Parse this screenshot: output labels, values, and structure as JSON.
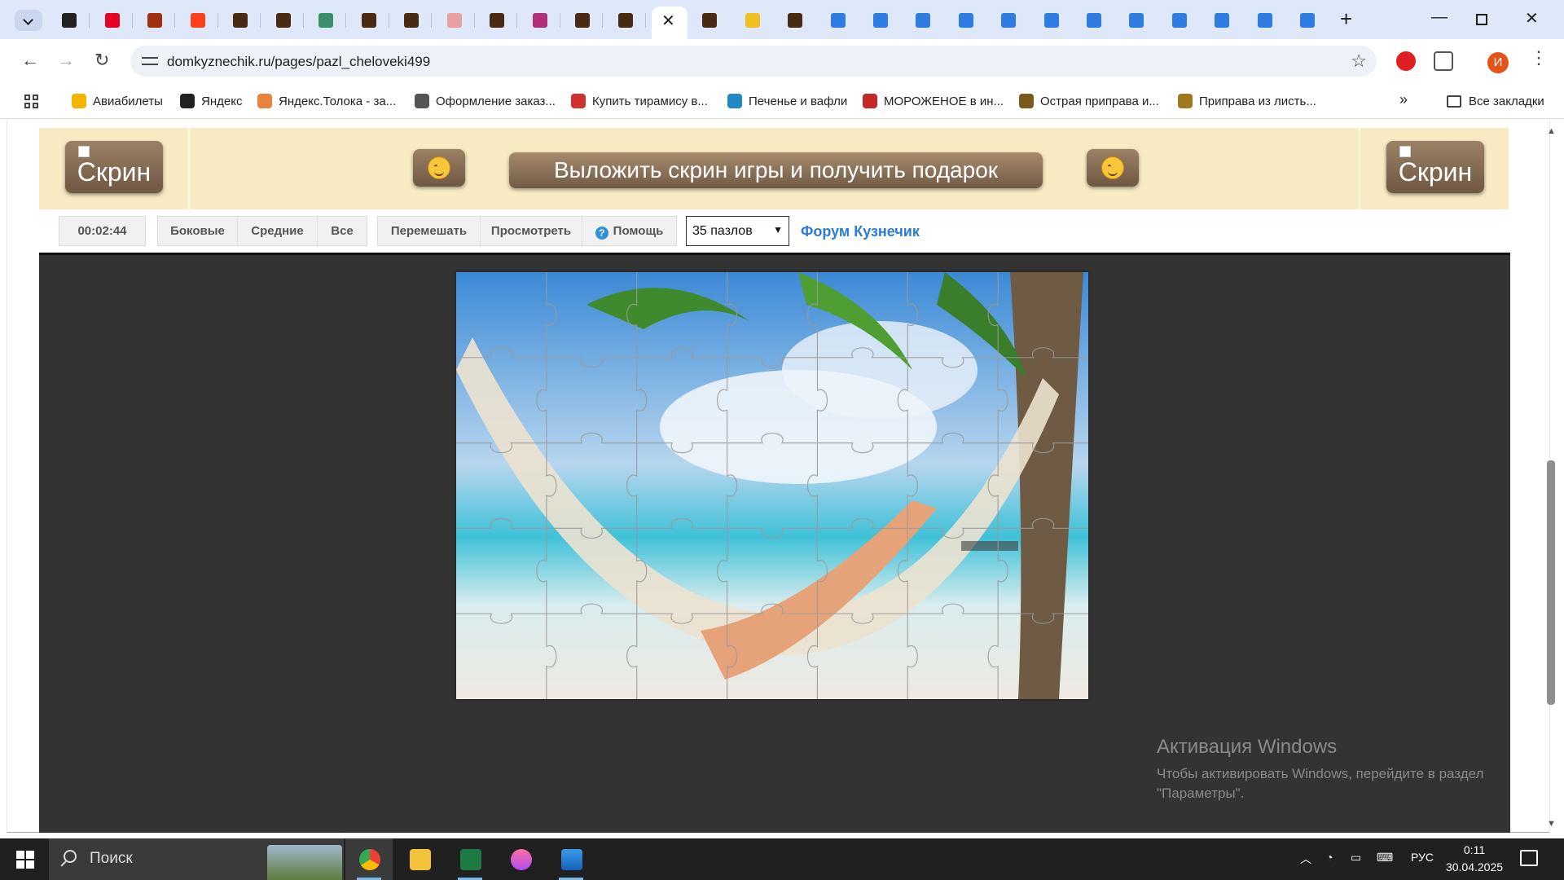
{
  "browser": {
    "active_tab_close": "✕",
    "new_tab": "+",
    "url": "domkyznechik.ru/pages/pazl_cheloveki499",
    "profile_initial": "И",
    "all_bookmarks": "Все закладки",
    "bookmarks": [
      {
        "label": "Авиабилеты",
        "color": "#f4b400"
      },
      {
        "label": "Яндекс",
        "color": "#222222"
      },
      {
        "label": "Яндекс.Толока - за...",
        "color": "#e9823a"
      },
      {
        "label": "Оформление заказ...",
        "color": "#555555"
      },
      {
        "label": "Купить тирамису в...",
        "color": "#d0312d"
      },
      {
        "label": "Печенье и вафли",
        "color": "#1e88c8"
      },
      {
        "label": "МОРОЖЕНОЕ в ин...",
        "color": "#c62828"
      },
      {
        "label": "Острая приправа и...",
        "color": "#7a5a18"
      },
      {
        "label": "Приправа из листь...",
        "color": "#a07820"
      }
    ]
  },
  "page": {
    "banner": {
      "skrin_left": "Скрин",
      "skrin_right": "Скрин",
      "cta": "Выложить скрин игры и получить подарок"
    },
    "controls": {
      "timer": "00:02:44",
      "side": "Боковые",
      "middle": "Средние",
      "all": "Все",
      "shuffle": "Перемешать",
      "preview": "Просмотреть",
      "help": "Помощь",
      "pieces_selected": "35 пазлов",
      "forum": "Форум Кузнечик"
    },
    "puzzle": {
      "columns": 7,
      "rows": 5
    },
    "activation": {
      "title": "Активация Windows",
      "subtitle": "Чтобы активировать Windows, перейдите в раздел \"Параметры\"."
    }
  },
  "taskbar": {
    "search": "Поиск",
    "language": "РУС",
    "time": "0:11",
    "date": "30.04.2025"
  }
}
